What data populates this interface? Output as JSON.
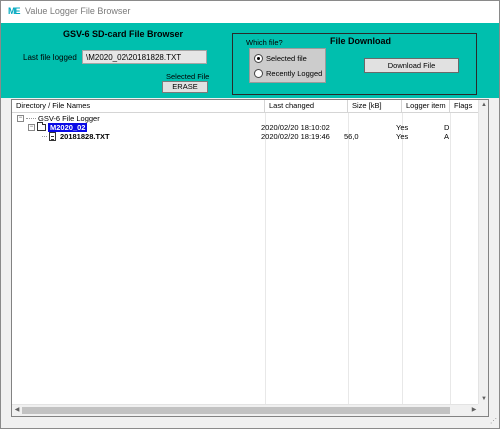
{
  "window": {
    "title": "Value Logger File Browser",
    "app_icon": "ME"
  },
  "sd_browser": {
    "title": "GSV-6 SD-card File Browser",
    "last_file_label": "Last file logged",
    "last_file_value": "\\M2020_02\\20181828.TXT",
    "selected_file_label": "Selected File",
    "erase_label": "ERASE"
  },
  "download": {
    "which_file_label": "Which file?",
    "title": "File Download",
    "options": [
      {
        "label": "Selected file",
        "checked": true
      },
      {
        "label": "Recently Logged",
        "checked": false
      }
    ],
    "button_label": "Download File"
  },
  "tree": {
    "columns": [
      "Directory / File Names",
      "Last changed",
      "Size [kB]",
      "Logger item",
      "Flags"
    ],
    "rows": [
      {
        "name": "GSV-6 File Logger",
        "last_changed": "",
        "size": "",
        "logger_item": "",
        "flags": "",
        "expander": "−"
      },
      {
        "name": "M2020_02",
        "last_changed": "2020/02/20 18:10:02",
        "size": "",
        "logger_item": "Yes",
        "flags": "D",
        "expander": "−"
      },
      {
        "name": "20181828.TXT",
        "last_changed": "2020/02/20 18:19:46",
        "size": "56,0",
        "logger_item": "Yes",
        "flags": "A",
        "expander": ""
      }
    ]
  },
  "colors": {
    "panel": "#00bfae",
    "selection": "#0a0ae6"
  }
}
